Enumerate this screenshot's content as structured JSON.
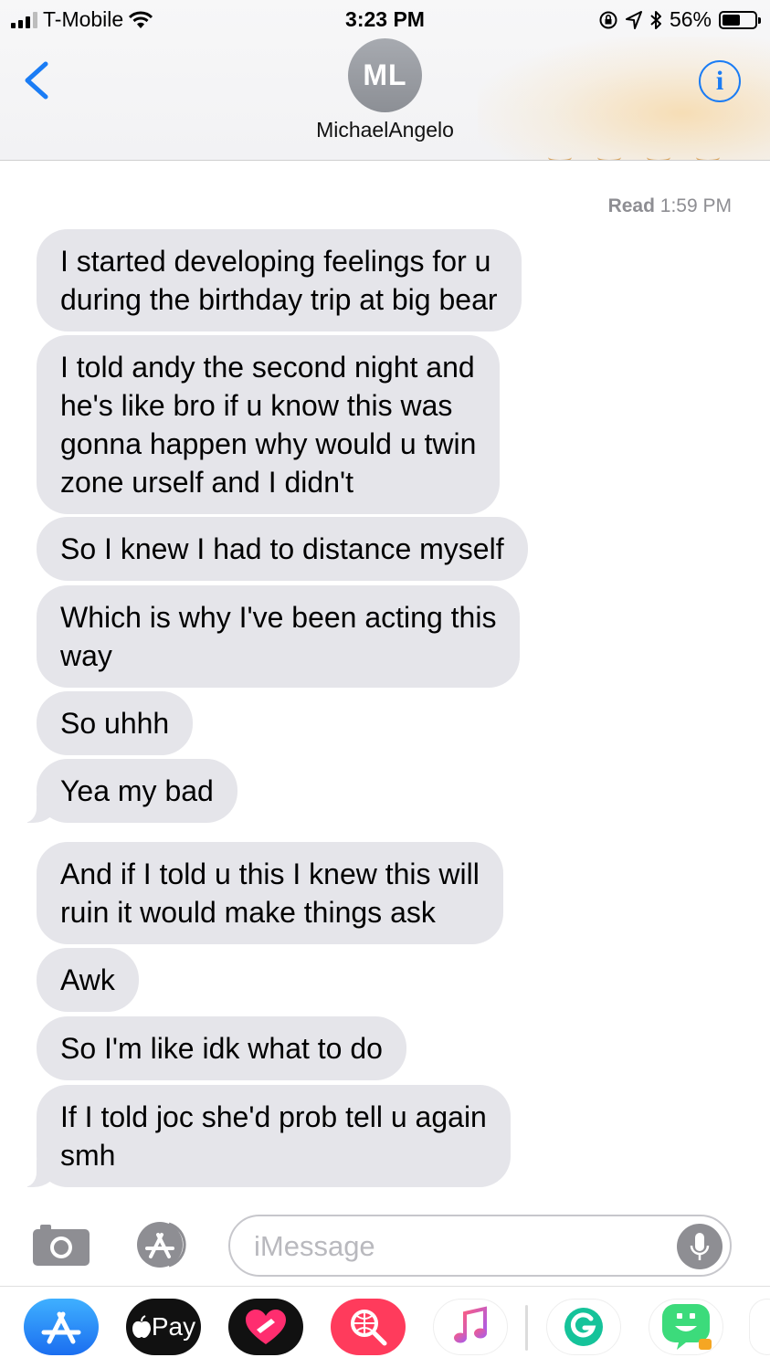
{
  "status_bar": {
    "carrier": "T-Mobile",
    "time": "3:23 PM",
    "battery": "56%",
    "battery_level": 0.56
  },
  "header": {
    "avatar_initials": "ML",
    "contact_name": "MichaelAngelo",
    "info_glyph": "i"
  },
  "conversation": {
    "read_label": "Read",
    "read_time": "1:59 PM",
    "messages": [
      "I started developing feelings for u\nduring the birthday trip at big bear",
      "I told andy the second night and\nhe's like bro if u know this was\ngonna happen why would u twin\nzone urself and I didn't",
      "So I knew I had to distance myself",
      "Which is why I've been acting this\nway",
      "So uhhh",
      "Yea my bad",
      "And if I told u this I knew this will\nruin it would make things ask",
      "Awk",
      "So I'm like idk what to do",
      "If I told joc she'd prob tell u again\nsmh"
    ]
  },
  "composer": {
    "placeholder": "iMessage"
  },
  "app_drawer": {
    "apple_pay_label": "Pay",
    "icons": [
      "app-store-icon",
      "apple-pay-icon",
      "digital-touch-icon",
      "web-images-icon",
      "music-icon",
      "grammarly-icon",
      "bitmoji-icon"
    ]
  },
  "colors": {
    "ios_blue": "#1a7cf5",
    "bubble_gray": "#e5e5ea",
    "secondary_text": "#8e8e93"
  }
}
